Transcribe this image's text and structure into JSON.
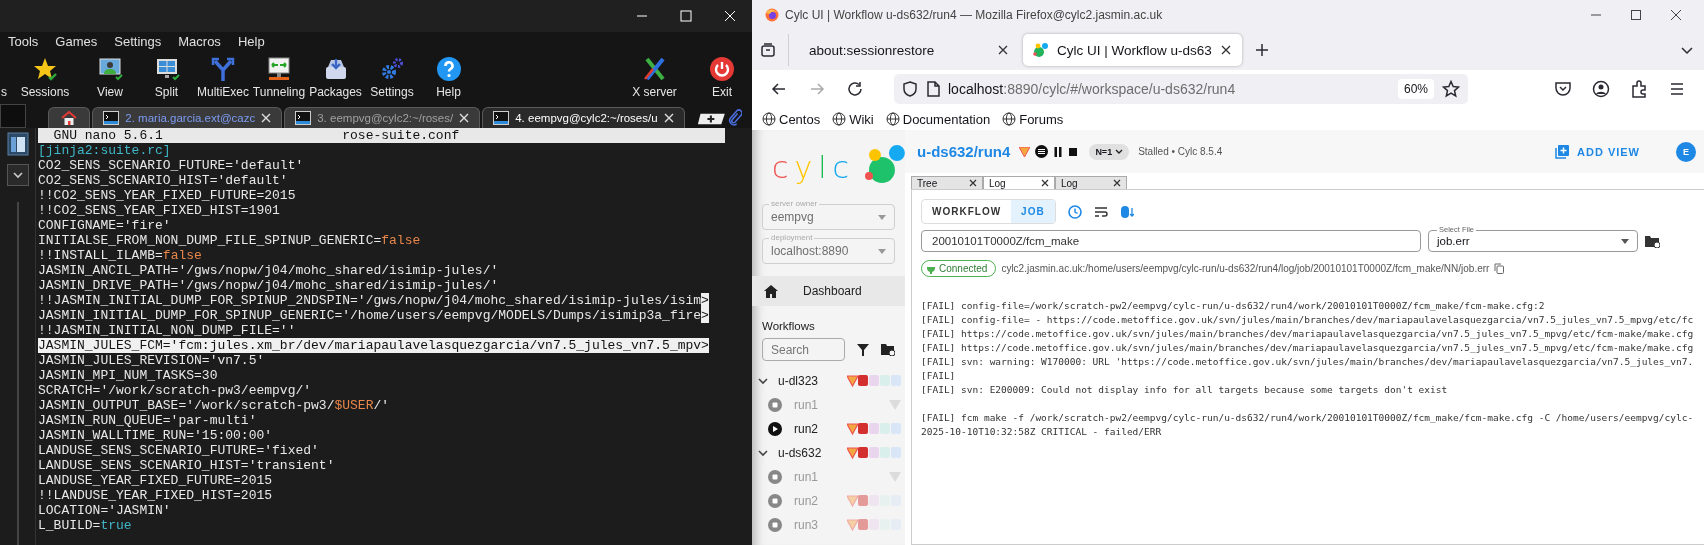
{
  "terminal": {
    "menu": [
      "Tools",
      "Games",
      "Settings",
      "Macros",
      "Help"
    ],
    "toolbar": [
      {
        "label": "s"
      },
      {
        "label": "Sessions"
      },
      {
        "label": "View"
      },
      {
        "label": "Split"
      },
      {
        "label": "MultiExec"
      },
      {
        "label": "Tunneling"
      },
      {
        "label": "Packages"
      },
      {
        "label": "Settings"
      },
      {
        "label": "Help"
      }
    ],
    "toolbar_right": [
      {
        "label": "X server"
      },
      {
        "label": "Exit"
      }
    ],
    "tabs": [
      {
        "kind": "home",
        "selected": false
      },
      {
        "kind": "session",
        "label": "2. maria.garcia.ext@cazc",
        "color": "#7c9cf2",
        "selected": false
      },
      {
        "kind": "session",
        "label": "3. eempvg@cylc2:~/roses/",
        "color": "#a0a0a0",
        "selected": false
      },
      {
        "kind": "session",
        "label": "4. eempvg@cylc2:~/roses/u",
        "color": "#ffffff",
        "selected": true
      }
    ],
    "nano": {
      "version": "GNU nano 5.6.1",
      "file": "rose-suite.conf",
      "lines": [
        {
          "highlighted": false,
          "segments": [
            {
              "text": "[jinja2:suite.rc]",
              "kind": "section"
            }
          ]
        },
        {
          "highlighted": false,
          "segments": [
            {
              "text": "CO2_SENS_SCENARIO_FUTURE='default'",
              "kind": "plain"
            }
          ]
        },
        {
          "highlighted": false,
          "segments": [
            {
              "text": "CO2_SENS_SCENARIO_HIST='default'",
              "kind": "plain"
            }
          ]
        },
        {
          "highlighted": false,
          "segments": [
            {
              "text": "!!CO2_SENS_YEAR_FIXED_FUTURE=2015",
              "kind": "plain"
            }
          ]
        },
        {
          "highlighted": false,
          "segments": [
            {
              "text": "!!CO2_SENS_YEAR_FIXED_HIST=1901",
              "kind": "plain"
            }
          ]
        },
        {
          "highlighted": false,
          "segments": [
            {
              "text": "CONFIGNAME='fire'",
              "kind": "plain"
            }
          ]
        },
        {
          "highlighted": false,
          "segments": [
            {
              "text": "INITIALSE_FROM_NON_DUMP_FILE_SPINUP_GENERIC=",
              "kind": "plain"
            },
            {
              "text": "false",
              "kind": "keyword"
            }
          ]
        },
        {
          "highlighted": false,
          "segments": [
            {
              "text": "!!INSTALL_ILAMB=",
              "kind": "plain"
            },
            {
              "text": "false",
              "kind": "keyword"
            }
          ]
        },
        {
          "highlighted": false,
          "segments": [
            {
              "text": "JASMIN_ANCIL_PATH='/gws/nopw/j04/mohc_shared/isimip-jules/'",
              "kind": "plain"
            }
          ]
        },
        {
          "highlighted": false,
          "segments": [
            {
              "text": "JASMIN_DRIVE_PATH='/gws/nopw/j04/mohc_shared/isimip-jules/'",
              "kind": "plain"
            }
          ]
        },
        {
          "highlighted": false,
          "segments": [
            {
              "text": "!!JASMIN_INITIAL_DUMP_FOR_SPINUP_2NDSPIN='/gws/nopw/j04/mohc_shared/isimip-jules/isim",
              "kind": "plain"
            },
            {
              "text": ">",
              "kind": "overflow"
            }
          ]
        },
        {
          "highlighted": false,
          "segments": [
            {
              "text": "JASMIN_INITIAL_DUMP_FOR_SPINUP_GENERIC='/home/users/eempvg/MODELS/Dumps/isimip3a_fire",
              "kind": "plain"
            },
            {
              "text": ">",
              "kind": "overflow"
            }
          ]
        },
        {
          "highlighted": false,
          "segments": [
            {
              "text": "!!JASMIN_INITIAL_NON_DUMP_FILE=''",
              "kind": "plain"
            }
          ]
        },
        {
          "highlighted": true,
          "segments": [
            {
              "text": "JASMIN_JULES_FCM='fcm:jules.xm_br/dev/mariapaulavelasquezgarcia/vn7.5_jules_vn7.5_mpv",
              "kind": "plain"
            },
            {
              "text": ">",
              "kind": "overflow"
            }
          ]
        },
        {
          "highlighted": false,
          "segments": [
            {
              "text": "JASMIN_JULES_REVISION='vn7.5'",
              "kind": "plain"
            }
          ]
        },
        {
          "highlighted": false,
          "segments": [
            {
              "text": "JASMIN_MPI_NUM_TASKS=30",
              "kind": "plain"
            }
          ]
        },
        {
          "highlighted": false,
          "segments": [
            {
              "text": "SCRATCH='/work/scratch-pw3/eempvg/'",
              "kind": "plain"
            }
          ]
        },
        {
          "highlighted": false,
          "segments": [
            {
              "text": "JASMIN_OUTPUT_BASE='/work/scratch-pw3/",
              "kind": "plain"
            },
            {
              "text": "$USER",
              "kind": "keyword"
            },
            {
              "text": "/'",
              "kind": "plain"
            }
          ]
        },
        {
          "highlighted": false,
          "segments": [
            {
              "text": "JASMIN_RUN_QUEUE='par-multi'",
              "kind": "plain"
            }
          ]
        },
        {
          "highlighted": false,
          "segments": [
            {
              "text": "JASMIN_WALLTIME_RUN='15:00:00'",
              "kind": "plain"
            }
          ]
        },
        {
          "highlighted": false,
          "segments": [
            {
              "text": "LANDUSE_SENS_SCENARIO_FUTURE='fixed'",
              "kind": "plain"
            }
          ]
        },
        {
          "highlighted": false,
          "segments": [
            {
              "text": "LANDUSE_SENS_SCENARIO_HIST='transient'",
              "kind": "plain"
            }
          ]
        },
        {
          "highlighted": false,
          "segments": [
            {
              "text": "LANDUSE_YEAR_FIXED_FUTURE=2015",
              "kind": "plain"
            }
          ]
        },
        {
          "highlighted": false,
          "segments": [
            {
              "text": "!!LANDUSE_YEAR_FIXED_HIST=2015",
              "kind": "plain"
            }
          ]
        },
        {
          "highlighted": false,
          "segments": [
            {
              "text": "LOCATION='JASMIN'",
              "kind": "plain"
            }
          ]
        },
        {
          "highlighted": false,
          "segments": [
            {
              "text": "L_BUILD=",
              "kind": "plain"
            },
            {
              "text": "true",
              "kind": "literal"
            }
          ]
        }
      ]
    }
  },
  "browser": {
    "title": "Cylc UI | Workflow u-ds632/run4 — Mozilla Firefox@cylc2.jasmin.ac.uk",
    "tabs": [
      {
        "kind": "plain",
        "label": "about:sessionrestore",
        "selected": false
      },
      {
        "kind": "site",
        "label": "Cylc UI | Workflow u-ds63",
        "selected": true
      }
    ],
    "url": {
      "host": "localhost",
      "path": ":8890/cylc/#/workspace/u-ds632/run4"
    },
    "zoom": "60%",
    "bookmarks": [
      "Centos",
      "Wiki",
      "Documentation",
      "Forums"
    ]
  },
  "cylc": {
    "logo": "cylc",
    "sidebar": {
      "fields": [
        {
          "label": "server owner",
          "value": "eempvg",
          "disabled": true
        },
        {
          "label": "deployment",
          "value": "localhost:8890",
          "disabled": true
        }
      ],
      "nav": [
        "Dashboard"
      ],
      "workflows_title": "Workflows",
      "search": {
        "placeholder": "Search"
      },
      "workflows": [
        {
          "name": "u-dl323",
          "expanded": true,
          "children": [
            {
              "name": "run1",
              "stopped": true,
              "has_tasks": false
            },
            {
              "name": "run2",
              "stopped": false,
              "has_tasks": true
            }
          ]
        },
        {
          "name": "u-ds632",
          "expanded": true,
          "children": [
            {
              "name": "run1",
              "stopped": true,
              "has_tasks": false
            },
            {
              "name": "run2",
              "stopped": true,
              "has_tasks": true
            },
            {
              "name": "run3",
              "stopped": true,
              "has_tasks": true
            }
          ]
        }
      ]
    },
    "header": {
      "workflow": "u-ds632/run4",
      "chip": "N=1",
      "status": "Stalled • Cylc 8.5.4",
      "add_view": "ADD VIEW",
      "avatar": "E"
    },
    "tabs": [
      {
        "label": "Tree",
        "selected": false
      },
      {
        "label": "Log",
        "selected": true
      },
      {
        "label": "Log",
        "selected": false
      }
    ],
    "log": {
      "modes": [
        {
          "label": "WORKFLOW",
          "selected": false
        },
        {
          "label": "JOB",
          "selected": true
        }
      ],
      "task": "20010101T0000Z/fcm_make",
      "file": {
        "label": "Select File",
        "value": "job.err"
      },
      "connection": "Connected",
      "path": "cylc2.jasmin.ac.uk:/home/users/eempvg/cylc-run/u-ds632/run4/log/job/20010101T0000Z/fcm_make/NN/job.err",
      "lines": [
        {
          "kind": "text",
          "text": "[FAIL] config-file=/work/scratch-pw2/eempvg/cylc-run/u-ds632/run4/work/20010101T0000Z/fcm_make/fcm-make.cfg:2"
        },
        {
          "kind": "text",
          "text": "[FAIL] config-file= - https://code.metoffice.gov.uk/svn/jules/main/branches/dev/mariapaulavelasquezgarcia/vn7.5_jules_vn7.5_mpvg/etc/fc"
        },
        {
          "kind": "text",
          "text": "[FAIL] https://code.metoffice.gov.uk/svn/jules/main/branches/dev/mariapaulavelasquezgarcia/vn7.5_jules_vn7.5_mpvg/etc/fcm-make/make.cfg"
        },
        {
          "kind": "text",
          "text": "[FAIL] https://code.metoffice.gov.uk/svn/jules/main/branches/dev/mariapaulavelasquezgarcia/vn7.5_jules_vn7.5_mpvg/etc/fcm-make/make.cfg"
        },
        {
          "kind": "text",
          "text": "[FAIL] svn: warning: W170000: URL 'https://code.metoffice.gov.uk/svn/jules/main/branches/dev/mariapaulavelasquezgarcia/vn7.5_jules_vn7."
        },
        {
          "kind": "text",
          "text": "[FAIL]"
        },
        {
          "kind": "text",
          "text": "[FAIL] svn: E200009: Could not display info for all targets because some targets don't exist"
        },
        {
          "kind": "blank"
        },
        {
          "kind": "text",
          "text": "[FAIL] fcm make -f /work/scratch-pw2/eempvg/cylc-run/u-ds632/run4/work/20010101T0000Z/fcm_make/fcm-make.cfg -C /home/users/eempvg/cylc-"
        },
        {
          "kind": "text",
          "text": "2025-10-10T10:32:58Z CRITICAL - failed/ERR"
        }
      ]
    }
  }
}
